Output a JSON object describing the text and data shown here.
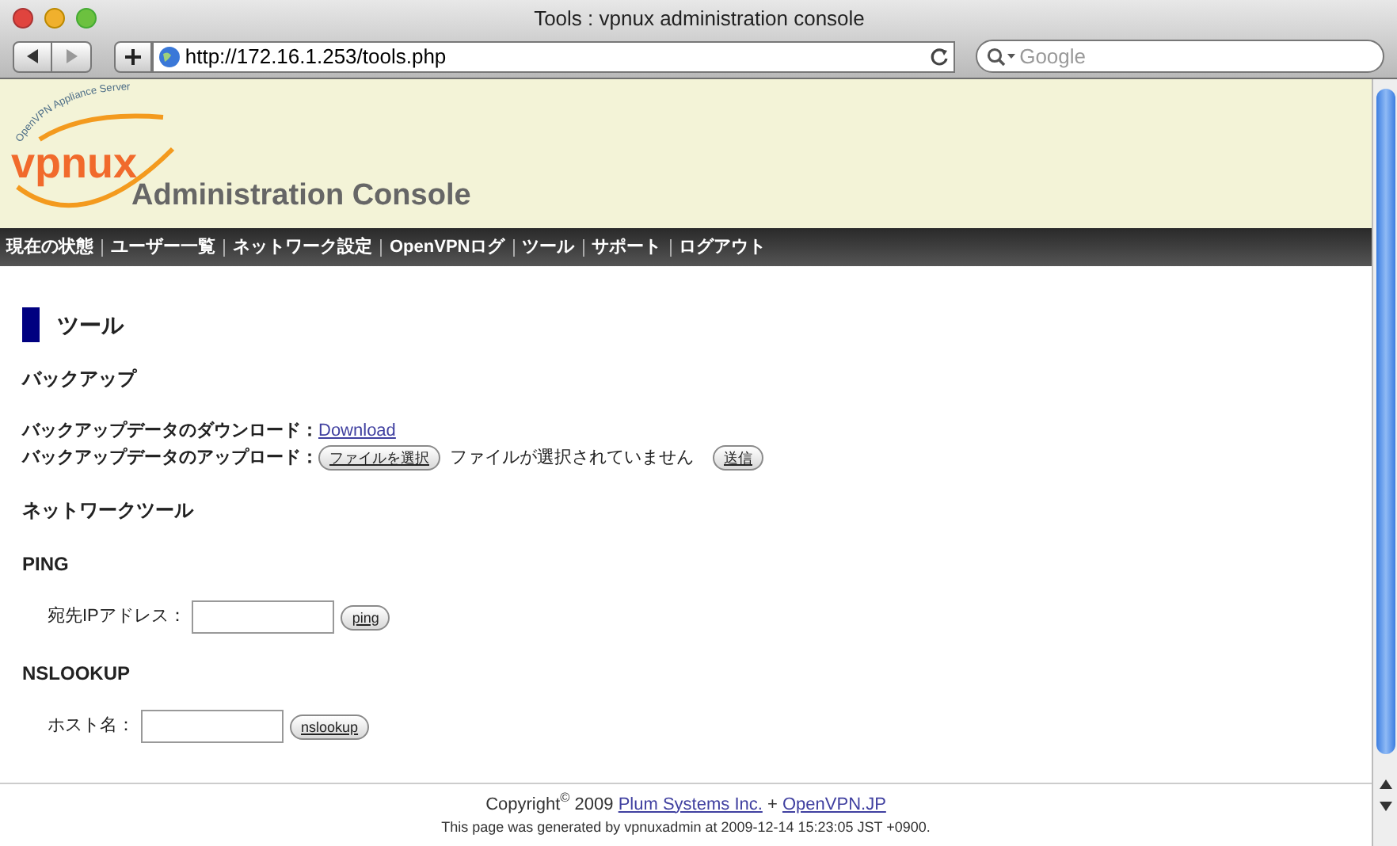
{
  "window": {
    "title": "Tools : vpnux administration console"
  },
  "toolbar": {
    "url": "http://172.16.1.253/tools.php",
    "search": {
      "placeholder": "Google"
    }
  },
  "header": {
    "logo_arc_text": "OpenVPN Appliance Server",
    "logo": "vpnux",
    "subtitle": "Administration Console"
  },
  "nav": [
    {
      "label": "現在の状態"
    },
    {
      "label": "ユーザー一覧"
    },
    {
      "label": "ネットワーク設定"
    },
    {
      "label": "OpenVPNログ"
    },
    {
      "label": "ツール"
    },
    {
      "label": "サポート"
    },
    {
      "label": "ログアウト"
    }
  ],
  "heading": "ツール",
  "backup": {
    "title": "バックアップ",
    "download_label": "バックアップデータのダウンロード：",
    "download_link": "Download",
    "upload_label": "バックアップデータのアップロード：",
    "file_button": "ファイルを選択",
    "file_status": "ファイルが選択されていません",
    "submit": "送信"
  },
  "network": {
    "title": "ネットワークツール",
    "tools": [
      {
        "title": "PING",
        "label": "宛先IPアドレス：",
        "button": "ping"
      },
      {
        "title": "NSLOOKUP",
        "label": "ホスト名：",
        "button": "nslookup"
      }
    ]
  },
  "footer": {
    "copyright": "Copyright$^{©}$ 2009",
    "company": "Plum Systems Inc.",
    "joiner": "+",
    "site": "OpenVPN.JP",
    "generated": "This page was generated by vpnuxadmin at 2009-12-14 15:23:05 JST +0900."
  }
}
